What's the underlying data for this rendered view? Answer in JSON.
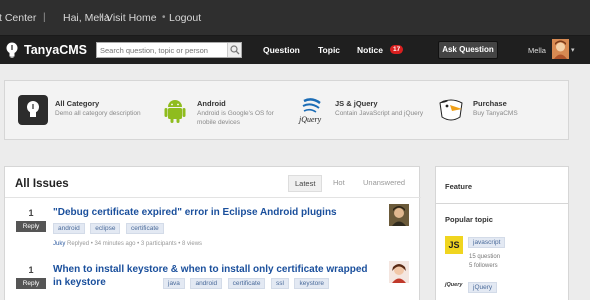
{
  "topbar": {
    "center": "t Center",
    "greeting": "Hai, Mella",
    "visit_home": "Visit Home",
    "logout": "Logout",
    "bullet": "•"
  },
  "navbar": {
    "logo_text": "TanyaCMS",
    "search_placeholder": "Search question, topic or person",
    "question": "Question",
    "topic": "Topic",
    "notice": "Notice",
    "notice_count": "17",
    "ask_question": "Ask Question",
    "user_name": "Mella",
    "caret": "▾"
  },
  "categories": [
    {
      "title": "All Category",
      "desc": "Demo all category description",
      "icon": "bulb-icon"
    },
    {
      "title": "Android",
      "desc": "Android is Google's OS for mobile devices",
      "icon": "android-icon"
    },
    {
      "title": "JS & jQuery",
      "desc": "Contain JavaScript and jQuery",
      "icon": "jquery-icon"
    },
    {
      "title": "Purchase",
      "desc": "Buy TanyaCMS",
      "icon": "eagle-icon"
    }
  ],
  "issues": {
    "heading": "All Issues",
    "tabs": [
      "Latest",
      "Hot",
      "Unanswered"
    ],
    "reply_label": "Reply",
    "items": [
      {
        "votes": "1",
        "title": "\"Debug certificate expired\" error in Eclipse Android plugins",
        "tags": [
          "android",
          "eclipse",
          "certificate"
        ],
        "author": "Juky",
        "meta": "Replyed • 34 minutes ago • 3 participants • 8 views"
      },
      {
        "votes": "1",
        "title": "When to install keystore & when to install only certificate wrapped in keystore",
        "tags": [
          "java",
          "android",
          "certificate",
          "ssl",
          "keystore"
        ],
        "author": "",
        "meta": ""
      }
    ]
  },
  "sidebar": {
    "feature_heading": "Feature",
    "popular_heading": "Popular topic",
    "popular": [
      {
        "icon_text": "JS",
        "tag": "javascript",
        "stats": [
          "15 question",
          "5 followers"
        ]
      },
      {
        "icon_text": "jQuery",
        "tag": "jQuery"
      }
    ]
  },
  "colors": {
    "topbar_bg": "#2f2f2f",
    "navbar_bg": "#1f1f1f",
    "notice_badge": "#d91f1f",
    "link_blue": "#1a4f9c",
    "tag_bg": "#e3e9f3",
    "android_green": "#8fbc1e",
    "js_yellow": "#f0d51f"
  }
}
